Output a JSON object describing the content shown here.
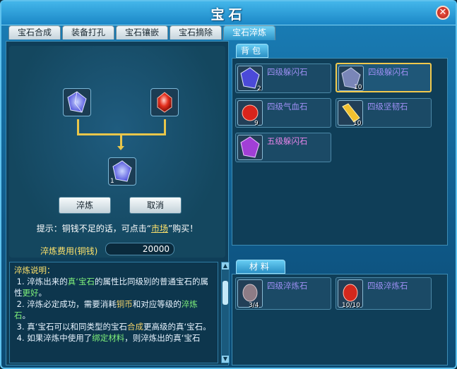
{
  "window": {
    "title": "宝石",
    "close_label": "✕"
  },
  "tabs": [
    {
      "label": "宝石合成",
      "active": false
    },
    {
      "label": "装备打孔",
      "active": false
    },
    {
      "label": "宝石镶嵌",
      "active": false
    },
    {
      "label": "宝石摘除",
      "active": false
    },
    {
      "label": "宝石淬炼",
      "active": true
    }
  ],
  "forge": {
    "refine_button": "淬炼",
    "cancel_button": "取消",
    "hint_prefix": "提示：铜钱不足的话，可点击“",
    "hint_link": "市场",
    "hint_suffix": "”购买！",
    "cost_label": "淬炼费用(铜钱)",
    "cost_value": "20000",
    "result_count": "1"
  },
  "description": {
    "heading": "淬炼说明：",
    "lines": [
      {
        "p1": "1. 淬炼出来的",
        "g1": "真‘宝石",
        "p2": "的属性比同级别的普通宝石的属性",
        "o1": "更好",
        "p3": "。"
      },
      {
        "p1": "2. 淬炼必定成功，需要消耗",
        "g1": "铜币",
        "p2": "和对应等级的",
        "o1": "淬炼石",
        "p3": "。"
      },
      {
        "p1": "3. 真‘宝石可以和同类型的宝石",
        "g1": "合成",
        "p2": "更高级的真‘宝石",
        "o1": "",
        "p3": "。"
      },
      {
        "p1": "4. 如果淬炼中使用了",
        "g1": "绑定材料",
        "p2": "，则淬炼出的真‘宝石",
        "o1": "",
        "p3": ""
      }
    ]
  },
  "backpack": {
    "label": "背包",
    "items": [
      {
        "name": "四级躲闪石",
        "count": "2",
        "color": "#9d8ff3",
        "gem": "blue",
        "selected": false
      },
      {
        "name": "四级躲闪石",
        "count": "10",
        "color": "#9d8ff3",
        "gem": "blue",
        "selected": true
      },
      {
        "name": "四级气血石",
        "count": "9",
        "color": "#9d8ff3",
        "gem": "red",
        "selected": false
      },
      {
        "name": "四级坚韧石",
        "count": "10",
        "color": "#9d8ff3",
        "gem": "gold",
        "selected": false
      },
      {
        "name": "五级躲闪石",
        "count": "",
        "color": "#e484e8",
        "gem": "purple",
        "selected": false
      }
    ]
  },
  "materials": {
    "label": "材料",
    "items": [
      {
        "name": "四级淬炼石",
        "count": "3/4",
        "gem": "refine-grey"
      },
      {
        "name": "四级淬炼石",
        "count": "10/10",
        "gem": "refine-red"
      }
    ]
  },
  "colors": {
    "accent": "#2a8fc4",
    "highlight": "#f2c94c",
    "link": "#ffe36b",
    "green_text": "#7ff07a"
  }
}
